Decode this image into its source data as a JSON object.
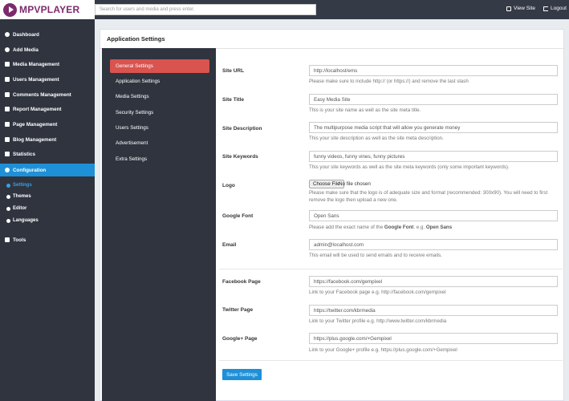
{
  "brand": {
    "name": "MPVPLAYER"
  },
  "search": {
    "placeholder": "Search for users and media and press enter."
  },
  "topnav": {
    "view_site": "View Site",
    "logout": "Logout"
  },
  "sidebar": {
    "items": [
      {
        "label": "Dashboard",
        "icon": "dashboard-icon"
      },
      {
        "label": "Add Media",
        "icon": "add-icon"
      },
      {
        "label": "Media Management",
        "icon": "media-icon"
      },
      {
        "label": "Users Management",
        "icon": "users-icon"
      },
      {
        "label": "Comments Management",
        "icon": "comments-icon"
      },
      {
        "label": "Report Management",
        "icon": "flag-icon"
      },
      {
        "label": "Page Management",
        "icon": "page-icon"
      },
      {
        "label": "Blog Management",
        "icon": "blog-icon"
      },
      {
        "label": "Statistics",
        "icon": "chart-icon"
      },
      {
        "label": "Configuration",
        "icon": "gear-icon"
      }
    ],
    "sub_items": [
      {
        "label": "Settings"
      },
      {
        "label": "Themes"
      },
      {
        "label": "Editor"
      },
      {
        "label": "Languages"
      }
    ],
    "tools": "Tools"
  },
  "card": {
    "title": "Application Settings"
  },
  "settings_nav": [
    "General Settings",
    "Application Settings",
    "Media Settings",
    "Security Settings",
    "Users Settings",
    "Advertisement",
    "Extra Settings"
  ],
  "form": {
    "site_url": {
      "label": "Site URL",
      "value": "http://localhost/ems",
      "help": "Please make sure to include http:// (or https://) and remove the last slash"
    },
    "site_title": {
      "label": "Site Title",
      "value": "Easy Media Site",
      "help": "This is your site name as well as the site meta title."
    },
    "site_description": {
      "label": "Site Description",
      "value": "The multipurpose media script that will allow you generate money",
      "help": "This your site description as well as the site meta description."
    },
    "site_keywords": {
      "label": "Site Keywords",
      "value": "funny videos, funny vines, funny pictures",
      "help": "This your site keywords as well as the site meta keywords (only some important keywords)."
    },
    "logo": {
      "label": "Logo",
      "button": "Choose File",
      "file_status": "No file chosen",
      "help": "Please make sure that the logo is of adequate size and format (recommended: 300x90). You will need to first remove the logo then upload a new one."
    },
    "google_font": {
      "label": "Google Font",
      "value": "Open Sans",
      "help_prefix": "Please add the exact name of the ",
      "help_bold1": "Google Font",
      "help_mid": ". e.g. ",
      "help_bold2": "Open Sans"
    },
    "email": {
      "label": "Email",
      "value": "admin@localhost.com",
      "help": "This email will be used to send emails and to receive emails."
    },
    "facebook": {
      "label": "Facebook Page",
      "value": "https://facebook.com/gempixel",
      "help": "Link to your Facebook page e.g. http://facebook.com/gempixel"
    },
    "twitter": {
      "label": "Twitter Page",
      "value": "https://twitter.com/kbrmedia",
      "help": "Link to your Twitter profile e.g. http://www.twitter.com/kbrmedia"
    },
    "google_plus": {
      "label": "Google+ Page",
      "value": "https://plus.google.com/+Gempixel",
      "help": "Link to your Google+ profile e.g. https://plus.google.com/+Gempixel"
    },
    "save": "Save Settings"
  },
  "colors": {
    "sidebar": "#2f343f",
    "accent": "#1e90d8",
    "active_tab": "#d9534f",
    "brand": "#7d2a6d"
  }
}
